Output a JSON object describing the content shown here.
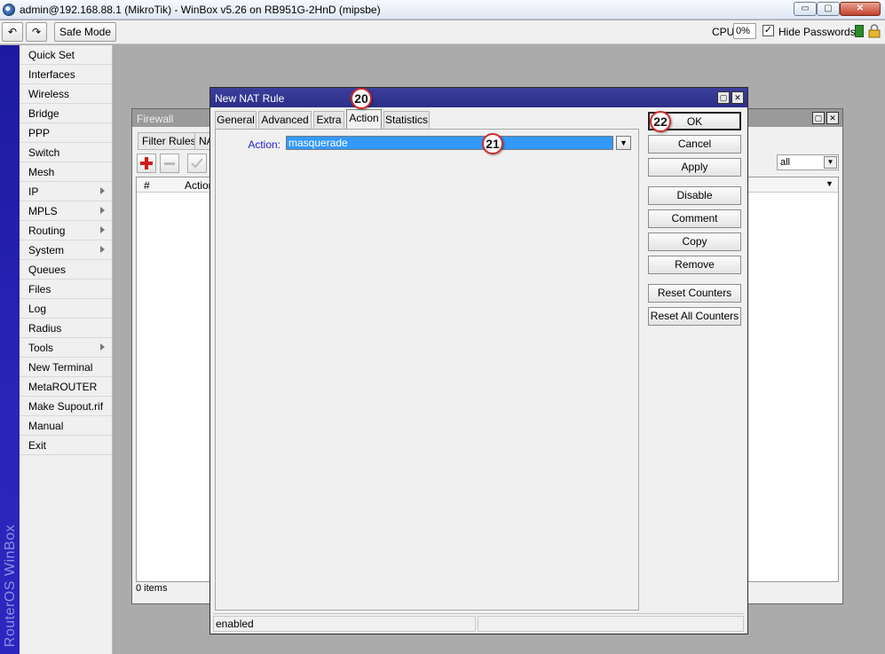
{
  "window": {
    "title": "admin@192.168.88.1 (MikroTik) - WinBox v5.26 on RB951G-2HnD (mipsbe)",
    "minimize_label": "▭",
    "maximize_label": "▢",
    "close_label": "✕"
  },
  "toolbar": {
    "undo_label": "↶",
    "redo_label": "↷",
    "safe_mode_label": "Safe Mode",
    "cpu_label": "CPU:",
    "cpu_value": "0%",
    "hide_passwords_checked": "✓",
    "hide_passwords_label": "Hide Passwords"
  },
  "sidebar": {
    "brand": "RouterOS WinBox",
    "items": [
      {
        "label": "Quick Set"
      },
      {
        "label": "Interfaces"
      },
      {
        "label": "Wireless"
      },
      {
        "label": "Bridge"
      },
      {
        "label": "PPP"
      },
      {
        "label": "Switch"
      },
      {
        "label": "Mesh"
      },
      {
        "label": "IP"
      },
      {
        "label": "MPLS"
      },
      {
        "label": "Routing"
      },
      {
        "label": "System"
      },
      {
        "label": "Queues"
      },
      {
        "label": "Files"
      },
      {
        "label": "Log"
      },
      {
        "label": "Radius"
      },
      {
        "label": "Tools"
      },
      {
        "label": "New Terminal"
      },
      {
        "label": "MetaROUTER"
      },
      {
        "label": "Make Supout.rif"
      },
      {
        "label": "Manual"
      },
      {
        "label": "Exit"
      }
    ]
  },
  "firewall": {
    "title": "Firewall",
    "tabs": [
      "Filter Rules",
      "NA"
    ],
    "columns": [
      "#",
      "Action"
    ],
    "filter_value": "all",
    "status": "0 items"
  },
  "dialog": {
    "title": "New NAT Rule",
    "tabs": [
      "General",
      "Advanced",
      "Extra",
      "Action",
      "Statistics"
    ],
    "action_label": "Action:",
    "action_value": "masquerade",
    "buttons": [
      "OK",
      "Cancel",
      "Apply",
      "Disable",
      "Comment",
      "Copy",
      "Remove",
      "Reset Counters",
      "Reset All Counters"
    ],
    "status": "enabled"
  },
  "markers": [
    "20",
    "21",
    "22"
  ],
  "colors": {
    "dialog_title": "#2c2e87",
    "selection": "#3399ff",
    "brand_bar": "#2a24b8",
    "marker_ring": "#d22c2c"
  }
}
